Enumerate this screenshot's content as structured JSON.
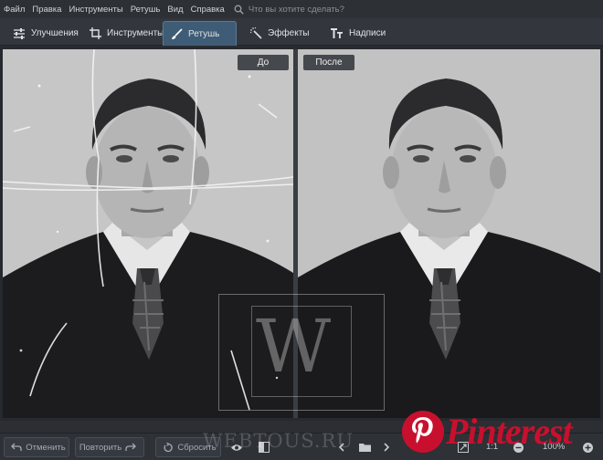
{
  "menu": [
    "Файл",
    "Правка",
    "Инструменты",
    "Ретушь",
    "Вид",
    "Справка"
  ],
  "search": {
    "placeholder": "Что вы хотите сделать?"
  },
  "tabs": [
    {
      "label": "Улучшения",
      "icon": "sliders-icon"
    },
    {
      "label": "Инструменты",
      "icon": "crop-icon"
    },
    {
      "label": "Ретушь",
      "icon": "brush-icon",
      "active": true
    },
    {
      "label": "Эффекты",
      "icon": "magic-wand-icon"
    },
    {
      "label": "Надписи",
      "icon": "text-icon"
    }
  ],
  "compare": {
    "before": "До",
    "after": "После"
  },
  "bottom": {
    "undo": "Отменить",
    "redo": "Повторить",
    "reset": "Сбросить",
    "ratio": "1:1",
    "zoom": "100%"
  },
  "watermark": {
    "letter": "W",
    "site": "WEBTOUS.RU"
  },
  "pinterest": {
    "word": "Pinterest"
  },
  "colors": {
    "accent_tab": "#3f5c77",
    "pinterest_red": "#c8102e",
    "background": "#2b2e33"
  }
}
